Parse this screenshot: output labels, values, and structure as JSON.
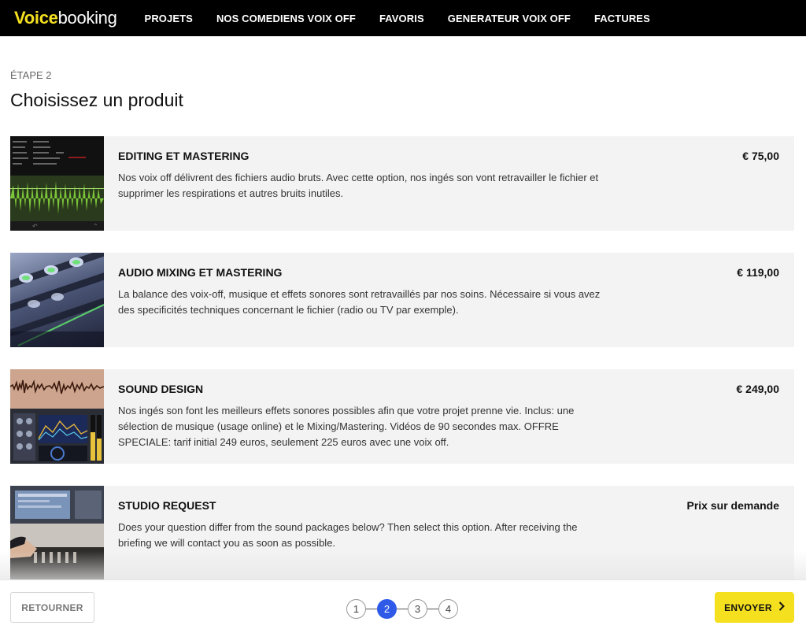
{
  "header": {
    "logo_part1": "Voice",
    "logo_part2": "booking",
    "nav": [
      "PROJETS",
      "NOS COMEDIENS VOIX OFF",
      "FAVORIS",
      "GENERATEUR VOIX OFF",
      "FACTURES"
    ]
  },
  "page": {
    "step_label": "ÉTAPE 2",
    "title": "Choisissez un produit"
  },
  "products": [
    {
      "title": "EDITING ET MASTERING",
      "price": "€ 75,00",
      "description": "Nos voix off délivrent des fichiers audio bruts. Avec cette option, nos ingés son vont retravailler le fichier et supprimer les respirations et autres bruits inutiles.",
      "image": "waveform-editor-thumbnail"
    },
    {
      "title": "AUDIO MIXING ET MASTERING",
      "price": "€ 119,00",
      "description": "La balance des voix-off, musique et effets sonores sont retravaillés par nos soins. Nécessaire si vous avez des specificités techniques concernant le fichier (radio ou TV par exemple).",
      "image": "mixing-console-thumbnail"
    },
    {
      "title": "SOUND DESIGN",
      "price": "€ 249,00",
      "description": "Nos ingés son font les meilleurs effets sonores possibles afin que votre projet prenne vie. Inclus: une sélection de musique (usage online) et le Mixing/Mastering. Vidéos de 90 secondes max. OFFRE SPECIALE: tarif initial 249 euros, seulement 225 euros avec une voix off.",
      "image": "sound-design-plugin-thumbnail"
    },
    {
      "title": "STUDIO REQUEST",
      "price": "Prix sur demande",
      "description": "Does your question differ from the sound packages below? Then select this option. After receiving the briefing we will contact you as soon as possible.",
      "image": "studio-engineer-thumbnail"
    }
  ],
  "footer": {
    "back_label": "RETOURNER",
    "send_label": "ENVOYER",
    "steps": [
      "1",
      "2",
      "3",
      "4"
    ],
    "active_step": "2"
  },
  "colors": {
    "topbar": "#000000",
    "brand_yellow": "#f5e01f",
    "active_step": "#2f5ae8",
    "card_bg": "#f3f3f3"
  }
}
